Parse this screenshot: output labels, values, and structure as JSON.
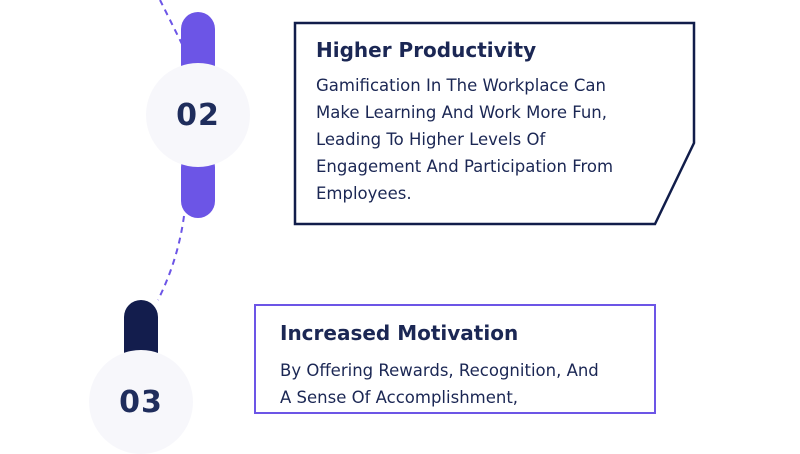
{
  "steps": [
    {
      "number": "02",
      "title": "Higher Productivity",
      "body_lines": [
        "Gamification In The Workplace Can",
        "Make Learning And Work More Fun,",
        "Leading To Higher Levels Of",
        "Engagement And Participation From",
        "Employees."
      ],
      "pill_color": "#6c55e6",
      "border_color": "#111d4a"
    },
    {
      "number": "03",
      "title": "Increased Motivation",
      "body_lines": [
        "By Offering Rewards, Recognition, And",
        "A Sense Of Accomplishment,"
      ],
      "pill_color": "#131d4d",
      "border_color": "#6c55e6"
    }
  ],
  "connector_color": "#6c55e6"
}
